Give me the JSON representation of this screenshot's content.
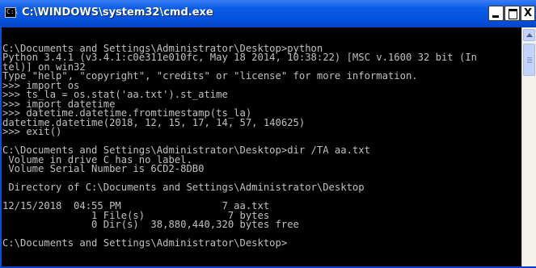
{
  "window": {
    "title": "C:\\WINDOWS\\system32\\cmd.exe",
    "icon_glyph": "C:\\",
    "buttons": {
      "minimize": "minimize-icon",
      "maximize": "maximize-icon",
      "close_label": "X"
    }
  },
  "console": {
    "lines": [
      "",
      "C:\\Documents and Settings\\Administrator\\Desktop>python",
      "Python 3.4.1 (v3.4.1:c0e311e010fc, May 18 2014, 10:38:22) [MSC v.1600 32 bit (In",
      "tel)] on win32",
      "Type \"help\", \"copyright\", \"credits\" or \"license\" for more information.",
      ">>> import os",
      ">>> ts_la = os.stat('aa.txt').st_atime",
      ">>> import datetime",
      ">>> datetime.datetime.fromtimestamp(ts_la)",
      "datetime.datetime(2018, 12, 15, 17, 14, 57, 140625)",
      ">>> exit()",
      "",
      "C:\\Documents and Settings\\Administrator\\Desktop>dir /TA aa.txt",
      " Volume in drive C has no label.",
      " Volume Serial Number is 6CD2-8DB0",
      "",
      " Directory of C:\\Documents and Settings\\Administrator\\Desktop",
      "",
      "12/15/2018  04:55 PM                 7 aa.txt",
      "               1 File(s)              7 bytes",
      "               0 Dir(s)  38,880,440,320 bytes free",
      "",
      "C:\\Documents and Settings\\Administrator\\Desktop>"
    ]
  },
  "colors": {
    "titlebar": "#0552dc",
    "console_bg": "#000000",
    "console_fg": "#c0c0c0"
  }
}
